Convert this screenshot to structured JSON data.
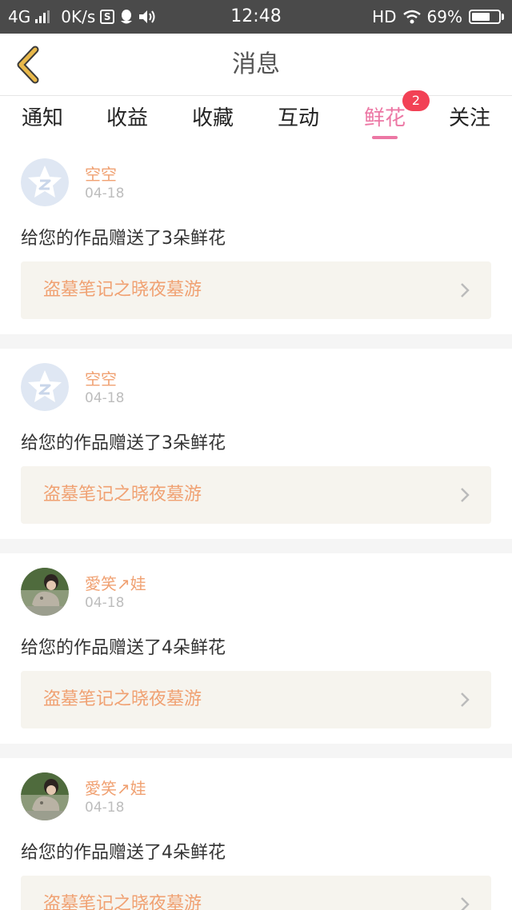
{
  "status_bar": {
    "network": "4G",
    "speed": "0K/s",
    "time": "12:48",
    "hd": "HD",
    "battery_percent": "69%",
    "battery_level": 0.69
  },
  "header": {
    "title": "消息",
    "back_icon": "chevron-left-icon",
    "back_color": "#e8b84a"
  },
  "tabs": [
    {
      "label": "通知",
      "active": false
    },
    {
      "label": "收益",
      "active": false
    },
    {
      "label": "收藏",
      "active": false
    },
    {
      "label": "互动",
      "active": false
    },
    {
      "label": "鲜花",
      "active": true,
      "badge": "2"
    },
    {
      "label": "关注",
      "active": false
    }
  ],
  "colors": {
    "accent_pink": "#ec77a4",
    "badge_red": "#f24155",
    "name_orange": "#f0a172",
    "link_bg": "#f6f4ee"
  },
  "messages": [
    {
      "user": "空空",
      "date": "04-18",
      "text": "给您的作品赠送了3朵鲜花",
      "work": "盗墓笔记之晓夜墓游",
      "avatar": "qq-default-avatar"
    },
    {
      "user": "空空",
      "date": "04-18",
      "text": "给您的作品赠送了3朵鲜花",
      "work": "盗墓笔记之晓夜墓游",
      "avatar": "qq-default-avatar"
    },
    {
      "user": "愛笑↗娃",
      "date": "04-18",
      "text": "给您的作品赠送了4朵鲜花",
      "work": "盗墓笔记之晓夜墓游",
      "avatar": "photo-avatar"
    },
    {
      "user": "愛笑↗娃",
      "date": "04-18",
      "text": "给您的作品赠送了4朵鲜花",
      "work": "盗墓笔记之晓夜墓游",
      "avatar": "photo-avatar"
    }
  ]
}
